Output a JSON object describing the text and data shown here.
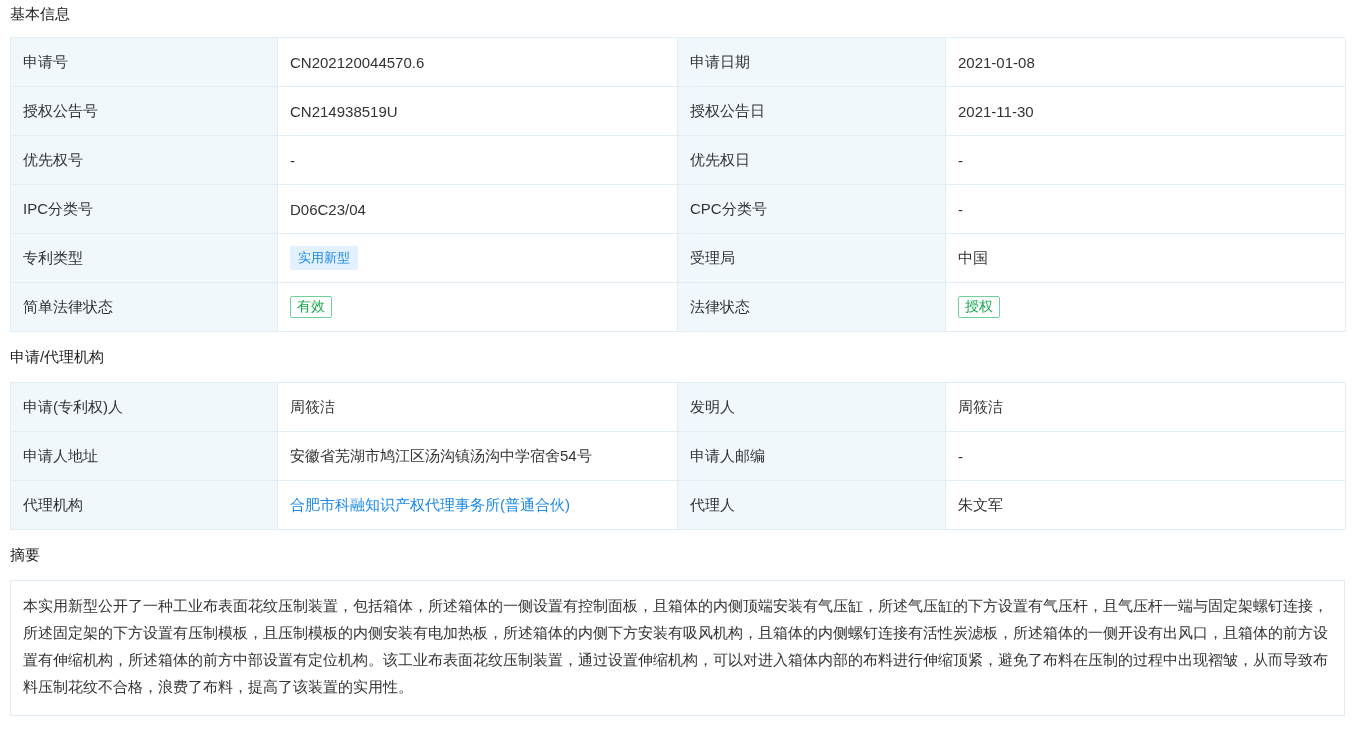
{
  "sections": [
    {
      "title": "基本信息",
      "rows": [
        [
          {
            "label": "申请号",
            "value": "CN202120044570.6",
            "kind": "text"
          },
          {
            "label": "申请日期",
            "value": "2021-01-08",
            "kind": "text"
          }
        ],
        [
          {
            "label": "授权公告号",
            "value": "CN214938519U",
            "kind": "text"
          },
          {
            "label": "授权公告日",
            "value": "2021-11-30",
            "kind": "text"
          }
        ],
        [
          {
            "label": "优先权号",
            "value": "-",
            "kind": "text"
          },
          {
            "label": "优先权日",
            "value": "-",
            "kind": "text"
          }
        ],
        [
          {
            "label": "IPC分类号",
            "value": "D06C23/04",
            "kind": "text"
          },
          {
            "label": "CPC分类号",
            "value": "-",
            "kind": "text"
          }
        ],
        [
          {
            "label": "专利类型",
            "value": "实用新型",
            "kind": "tag"
          },
          {
            "label": "受理局",
            "value": "中国",
            "kind": "text"
          }
        ],
        [
          {
            "label": "简单法律状态",
            "value": "有效",
            "kind": "status"
          },
          {
            "label": "法律状态",
            "value": "授权",
            "kind": "status"
          }
        ]
      ]
    },
    {
      "title": "申请/代理机构",
      "rows": [
        [
          {
            "label": "申请(专利权)人",
            "value": "周筱洁",
            "kind": "text"
          },
          {
            "label": "发明人",
            "value": "周筱洁",
            "kind": "text"
          }
        ],
        [
          {
            "label": "申请人地址",
            "value": "安徽省芜湖市鸠江区汤沟镇汤沟中学宿舍54号",
            "kind": "text"
          },
          {
            "label": "申请人邮编",
            "value": "-",
            "kind": "text"
          }
        ],
        [
          {
            "label": "代理机构",
            "value": "合肥市科融知识产权代理事务所(普通合伙)",
            "kind": "link"
          },
          {
            "label": "代理人",
            "value": "朱文军",
            "kind": "text"
          }
        ]
      ]
    }
  ],
  "abstract": {
    "title": "摘要",
    "text": "本实用新型公开了一种工业布表面花纹压制装置，包括箱体，所述箱体的一侧设置有控制面板，且箱体的内侧顶端安装有气压缸，所述气压缸的下方设置有气压杆，且气压杆一端与固定架螺钉连接，所述固定架的下方设置有压制模板，且压制模板的内侧安装有电加热板，所述箱体的内侧下方安装有吸风机构，且箱体的内侧螺钉连接有活性炭滤板，所述箱体的一侧开设有出风口，且箱体的前方设置有伸缩机构，所述箱体的前方中部设置有定位机构。该工业布表面花纹压制装置，通过设置伸缩机构，可以对进入箱体内部的布料进行伸缩顶紧，避免了布料在压制的过程中出现褶皱，从而导致布料压制花纹不合格，浪费了布料，提高了该装置的实用性。"
  }
}
